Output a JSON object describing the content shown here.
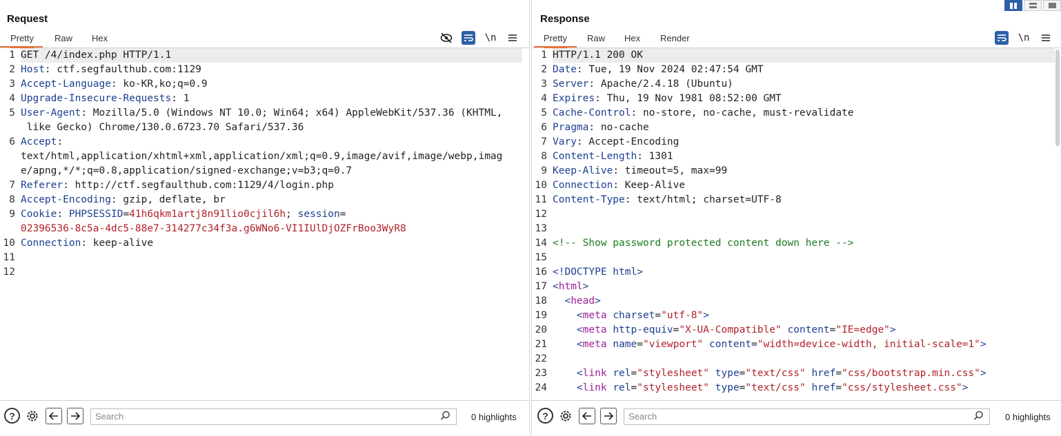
{
  "request": {
    "title": "Request",
    "tabs": [
      "Pretty",
      "Raw",
      "Hex"
    ],
    "icons": [
      "hide-eye-icon",
      "wrap-icon",
      "newline-icon",
      "menu-icon"
    ],
    "newline_glyph": "\\n",
    "search_placeholder": "Search",
    "highlights": "0 highlights",
    "lines": [
      {
        "n": "1"
      },
      {
        "n": "2"
      },
      {
        "n": "3"
      },
      {
        "n": "4"
      },
      {
        "n": "5"
      },
      {
        "n": ""
      },
      {
        "n": "6"
      },
      {
        "n": ""
      },
      {
        "n": ""
      },
      {
        "n": "7"
      },
      {
        "n": "8"
      },
      {
        "n": "9"
      },
      {
        "n": ""
      },
      {
        "n": "10"
      },
      {
        "n": "11"
      },
      {
        "n": "12"
      }
    ],
    "l1": "GET /4/index.php HTTP/1.1",
    "h2k": "Host",
    "h2v": " ctf.segfaulthub.com:1129",
    "h3k": "Accept-Language",
    "h3v": " ko-KR,ko;q=0.9",
    "h4k": "Upgrade-Insecure-Requests",
    "h4v": " 1",
    "h5k": "User-Agent",
    "h5v": " Mozilla/5.0 (Windows NT 10.0; Win64; x64) AppleWebKit/537.36 (KHTML,",
    "h5c": " like Gecko) Chrome/130.0.6723.70 Safari/537.36",
    "h6k": "Accept",
    "h6a": "text/html,application/xhtml+xml,application/xml;q=0.9,image/avif,image/webp,imag",
    "h6b": "e/apng,*/*;q=0.8,application/signed-exchange;v=b3;q=0.7",
    "h7k": "Referer",
    "h7v": " http://ctf.segfaulthub.com:1129/4/login.php",
    "h8k": "Accept-Encoding",
    "h8v": " gzip, deflate, br",
    "h9k": "Cookie",
    "c1k": "PHPSESSID",
    "c1v": "41h6qkm1artj8n91lio0cjil6h",
    "c2k": "session",
    "c2v": "02396536-8c5a-4dc5-88e7-314277c34f3a.g6WNo6-VI1IUlDjOZFrBoo3WyR8",
    "h10k": "Connection",
    "h10v": " keep-alive"
  },
  "response": {
    "title": "Response",
    "tabs": [
      "Pretty",
      "Raw",
      "Hex",
      "Render"
    ],
    "newline_glyph": "\\n",
    "search_placeholder": "Search",
    "highlights": "0 highlights",
    "l1": "HTTP/1.1 200 OK",
    "h2k": "Date",
    "h2v": " Tue, 19 Nov 2024 02:47:54 GMT",
    "h3k": "Server",
    "h3v": " Apache/2.4.18 (Ubuntu)",
    "h4k": "Expires",
    "h4v": " Thu, 19 Nov 1981 08:52:00 GMT",
    "h5k": "Cache-Control",
    "h5v": " no-store, no-cache, must-revalidate",
    "h6k": "Pragma",
    "h6v": " no-cache",
    "h7k": "Vary",
    "h7v": " Accept-Encoding",
    "h8k": "Content-Length",
    "h8v": " 1301",
    "h9k": "Keep-Alive",
    "h9v": " timeout=5, max=99",
    "h10k": "Connection",
    "h10v": " Keep-Alive",
    "h11k": "Content-Type",
    "h11v": " text/html; charset=UTF-8",
    "comment": "<!-- Show password protected content down here -->",
    "doctype": "<!DOCTYPE html>",
    "html_tag": "html",
    "head_tag": "head",
    "meta": "meta",
    "link": "link",
    "a_charset": "charset",
    "v_charset": "\"utf-8\"",
    "a_httpequiv": "http-equiv",
    "v_httpequiv": "\"X-UA-Compatible\"",
    "a_content": "content",
    "v_content_ie": "\"IE=edge\"",
    "a_name": "name",
    "v_name": "\"viewport\"",
    "v_content_vp": "\"width=device-width, initial-scale=1\"",
    "a_rel": "rel",
    "v_rel": "\"stylesheet\"",
    "a_type": "type",
    "v_type": "\"text/css\"",
    "a_href": "href",
    "v_href1": "\"css/bootstrap.min.css\"",
    "v_href2": "\"css/stylesheet.css\""
  }
}
